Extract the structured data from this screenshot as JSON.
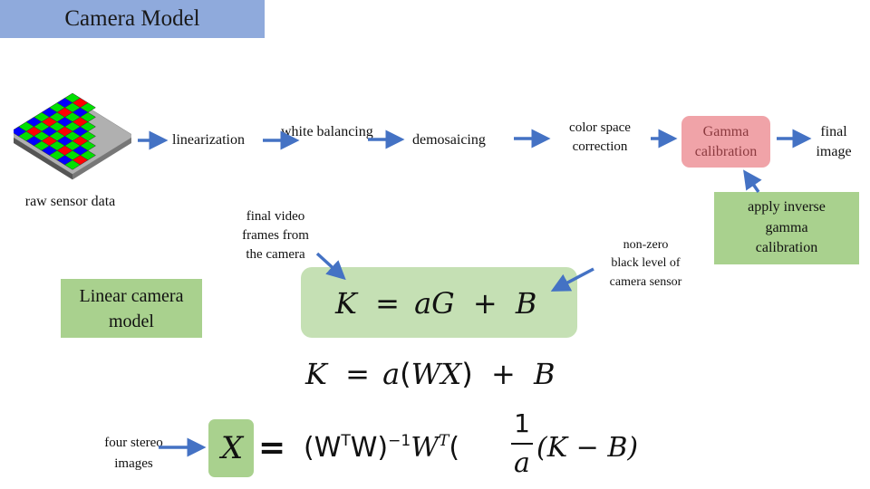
{
  "title": "Camera Model",
  "pipeline": {
    "source_label": "raw sensor data",
    "steps": [
      {
        "id": "linearization",
        "label": "linearization"
      },
      {
        "id": "white-balancing",
        "label": "white balancing"
      },
      {
        "id": "demosaicing",
        "label": "demosaicing"
      },
      {
        "id": "color-space-correction",
        "label_lines": [
          "color space",
          "correction"
        ]
      },
      {
        "id": "gamma-calibration",
        "label_lines": [
          "Gamma",
          "calibration"
        ]
      },
      {
        "id": "final-image",
        "label_lines": [
          "final",
          "image"
        ]
      }
    ]
  },
  "annotations": {
    "inverse_gamma": [
      "apply inverse",
      "gamma",
      "calibration"
    ],
    "final_video": [
      "final video",
      "frames from",
      "the camera"
    ],
    "black_level": [
      "non-zero",
      "black level of",
      "camera sensor"
    ],
    "four_stereo": [
      "four stereo",
      "images"
    ]
  },
  "linear_model_box": [
    "Linear camera",
    "model"
  ],
  "equations": {
    "eq1": {
      "K": "K",
      "eq": "=",
      "a": "a",
      "G": "G",
      "plus": "+",
      "B": "B"
    },
    "eq2": {
      "K": "K",
      "eq": "=",
      "a": "a",
      "lp": "(",
      "W": "W",
      "X": "X",
      "rp": ")",
      "plus": "+",
      "B": "B"
    },
    "eq3": {
      "X": "X",
      "eq": "=",
      "lhs_paren": "(W",
      "sup_T": "T",
      "rhs_paren": "W)",
      "sup_inv": "−1",
      "W": "W",
      "sup_T2": "T",
      "open": "(",
      "num": "1",
      "den": "a",
      "tail": "(K − B)"
    }
  },
  "colors": {
    "title_bg": "#8faadc",
    "arrow": "#4472c4",
    "gamma_box": "#f0a3a8",
    "green_box": "#a9d18e",
    "light_green_box": "#c5e0b4",
    "bayer_red": "#ff0000",
    "bayer_green": "#00e000",
    "bayer_blue": "#0000ff",
    "sensor_gray": "#b0b0b0"
  }
}
